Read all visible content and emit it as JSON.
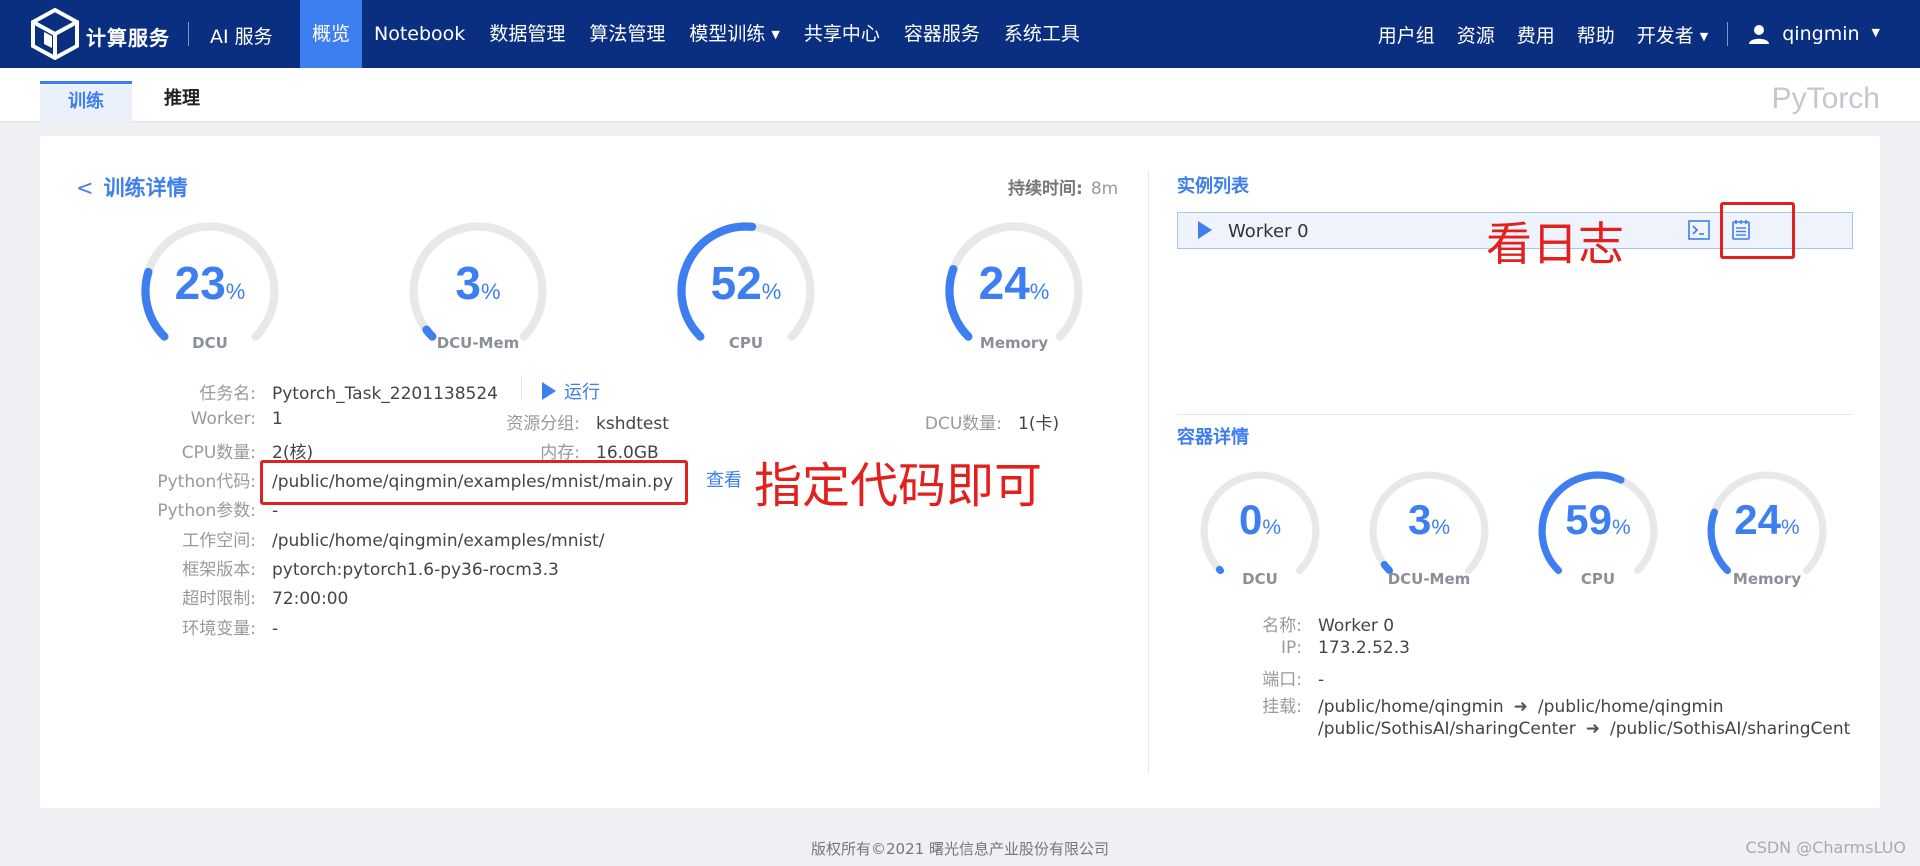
{
  "app": {
    "brand": "计算服务",
    "ai_service": "AI 服务"
  },
  "nav": {
    "items": [
      {
        "label": "概览",
        "active": true
      },
      {
        "label": "Notebook",
        "active": false
      },
      {
        "label": "数据管理",
        "active": false
      },
      {
        "label": "算法管理",
        "active": false
      },
      {
        "label": "模型训练",
        "active": false,
        "dropdown": true
      },
      {
        "label": "共享中心",
        "active": false
      },
      {
        "label": "容器服务",
        "active": false
      },
      {
        "label": "系统工具",
        "active": false
      }
    ],
    "right": [
      "用户组",
      "资源",
      "费用",
      "帮助",
      "开发者"
    ],
    "user": "qingmin"
  },
  "subtabs": {
    "train": "训练",
    "infer": "推理",
    "framework": "PyTorch"
  },
  "detail": {
    "back_label": "训练详情",
    "duration_label": "持续时间:",
    "duration_value": "8m",
    "gauges": [
      {
        "label": "DCU",
        "value": "23",
        "unit": "%",
        "percent": 23
      },
      {
        "label": "DCU-Mem",
        "value": "3",
        "unit": "%",
        "percent": 3
      },
      {
        "label": "CPU",
        "value": "52",
        "unit": "%",
        "percent": 52
      },
      {
        "label": "Memory",
        "value": "24",
        "unit": "%",
        "percent": 24
      }
    ],
    "task_name_key": "任务名:",
    "task_name": "Pytorch_Task_2201138524",
    "run_label": "运行",
    "worker_key": "Worker:",
    "worker": "1",
    "resource_group_key": "资源分组:",
    "resource_group": "kshdtest",
    "dcu_count_key": "DCU数量:",
    "dcu_count": "1(卡)",
    "cpu_count_key": "CPU数量:",
    "cpu_count": "2(核)",
    "memory_key": "内存:",
    "memory": "16.0GB",
    "python_code_key": "Python代码:",
    "python_code": "/public/home/qingmin/examples/mnist/main.py",
    "view_label": "查看",
    "python_params_key": "Python参数:",
    "python_params": "-",
    "workspace_key": "工作空间:",
    "workspace": "/public/home/qingmin/examples/mnist/",
    "framework_version_key": "框架版本:",
    "framework_version": "pytorch:pytorch1.6-py36-rocm3.3",
    "timeout_key": "超时限制:",
    "timeout": "72:00:00",
    "env_key": "环境变量:",
    "env": "-",
    "annotation": "指定代码即可"
  },
  "instances": {
    "title": "实例列表",
    "worker": "Worker 0",
    "annotation": "看日志"
  },
  "container": {
    "title": "容器详情",
    "gauges": [
      {
        "label": "DCU",
        "value": "0",
        "unit": "%",
        "percent": 0
      },
      {
        "label": "DCU-Mem",
        "value": "3",
        "unit": "%",
        "percent": 3
      },
      {
        "label": "CPU",
        "value": "59",
        "unit": "%",
        "percent": 59
      },
      {
        "label": "Memory",
        "value": "24",
        "unit": "%",
        "percent": 24
      }
    ],
    "name_key": "名称:",
    "name": "Worker 0",
    "ip_key": "IP:",
    "ip": "173.2.52.3",
    "port_key": "端口:",
    "port": "-",
    "mount_key": "挂载:",
    "mounts": [
      {
        "from": "/public/home/qingmin",
        "to": "/public/home/qingmin"
      },
      {
        "from": "/public/SothisAI/sharingCenter",
        "to": "/public/SothisAI/sharingCent"
      }
    ]
  },
  "footer": "版权所有©2021 曙光信息产业股份有限公司",
  "watermark": "CSDN @CharmsLUO",
  "colors": {
    "nav_bg": "#0b2f80",
    "accent": "#3d7ef0",
    "annotation": "#e2201d",
    "track": "#e8e8e8"
  }
}
